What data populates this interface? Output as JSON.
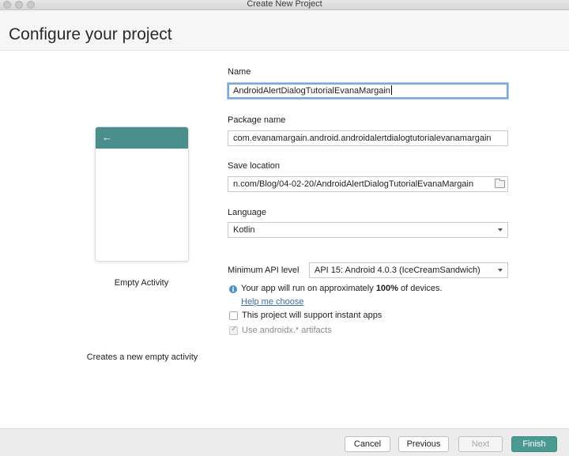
{
  "window": {
    "title": "Create New Project"
  },
  "page_title": "Configure your project",
  "template": {
    "name": "Empty Activity",
    "description": "Creates a new empty activity"
  },
  "form": {
    "name_label": "Name",
    "name_value": "AndroidAlertDialogTutorialEvanaMargain",
    "package_label": "Package name",
    "package_value": "com.evanamargain.android.androidalertdialogtutorialevanamargain",
    "save_label": "Save location",
    "save_value": "n.com/Blog/04-02-20/AndroidAlertDialogTutorialEvanaMargain",
    "language_label": "Language",
    "language_value": "Kotlin",
    "min_api_label": "Minimum API level",
    "min_api_value": "API 15: Android 4.0.3 (IceCreamSandwich)",
    "info_prefix": "Your app will run on approximately ",
    "info_percent": "100%",
    "info_suffix": " of devices.",
    "help_link": "Help me choose",
    "instant_apps_label": "This project will support instant apps",
    "instant_apps_checked": false,
    "androidx_label": "Use androidx.* artifacts",
    "androidx_checked": true
  },
  "footer": {
    "cancel": "Cancel",
    "previous": "Previous",
    "next": "Next",
    "finish": "Finish"
  },
  "colors": {
    "accent": "#4a9a92",
    "appbar": "#4a8f8b",
    "link": "#3c6fa3",
    "info": "#4a8fc7"
  }
}
